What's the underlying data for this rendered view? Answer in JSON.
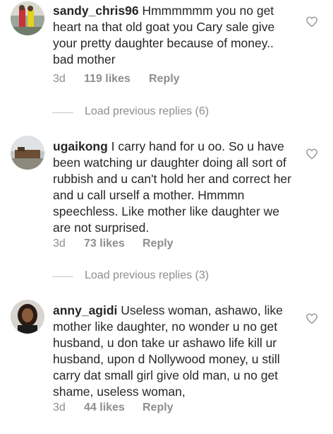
{
  "comments": [
    {
      "username": "sandy_chris96",
      "text": " Hmmmmmm you no get heart na that old goat you Cary sale give your pretty daughter because of money.. bad mother",
      "time": "3d",
      "likes": "119 likes",
      "reply": "Reply"
    },
    {
      "username": "ugaikong",
      "text": " I carry hand for u oo. So u have been watching ur daughter doing all sort of rubbish and u can't hold her and correct her and u call urself a mother. Hmmmn speechless. Like mother like daughter we are not surprised.",
      "time": "3d",
      "likes": "73 likes",
      "reply": "Reply"
    },
    {
      "username": "anny_agidi",
      "text": " Useless woman, ashawo, like mother like daughter, no wonder u no get husband, u don take ur ashawo life kill ur husband, upon d Nollywood money, u still carry dat small girl give old man, u no get shame, useless woman,",
      "time": "3d",
      "likes": "44 likes",
      "reply": "Reply"
    }
  ],
  "load_previous": [
    "Load previous replies (6)",
    "Load previous replies (3)"
  ],
  "icons": {
    "like": "heart-outline-icon"
  },
  "colors": {
    "text": "#262626",
    "secondary": "#8e8e8e",
    "divider": "#c7c7c7"
  }
}
